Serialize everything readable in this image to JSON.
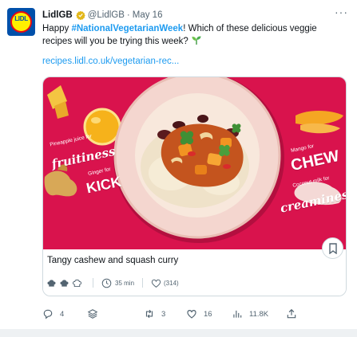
{
  "account": {
    "name": "LidlGB",
    "handle": "@LidlGB",
    "separator": "·",
    "date": "May 16",
    "avatar_label": "LIDL"
  },
  "tweet": {
    "text_prefix": "Happy ",
    "hashtag": "#NationalVegetarianWeek",
    "text_suffix": "! Which of these delicious veggie recipes will you be trying this week? ",
    "emoji": "seedling",
    "link": "recipes.lidl.co.uk/vegetarian-rec..."
  },
  "card": {
    "image_text": {
      "pineapple_label": "Pineapple juice for",
      "pineapple_word": "fruitiness",
      "ginger_label": "Ginger for",
      "ginger_word": "KICK",
      "mango_label": "Mango for",
      "mango_word": "CHEW",
      "coconut_label": "Coconut milk for",
      "coconut_word": "creaminess"
    },
    "title": "Tangy cashew and squash curry",
    "difficulty_icons": [
      "chef-hat-icon",
      "chef-hat-icon",
      "chef-hat-outline-icon"
    ],
    "time": "35 min",
    "likes": "(314)"
  },
  "actions": {
    "replies": "4",
    "retweets": "3",
    "likes": "16",
    "views": "11.8K"
  },
  "colors": {
    "accent": "#1d9bf0",
    "card_bg": "#d9134d",
    "verified": "#e2b719",
    "lidl_blue": "#0050aa",
    "lidl_yellow": "#fff000",
    "lidl_red": "#e60a14"
  }
}
